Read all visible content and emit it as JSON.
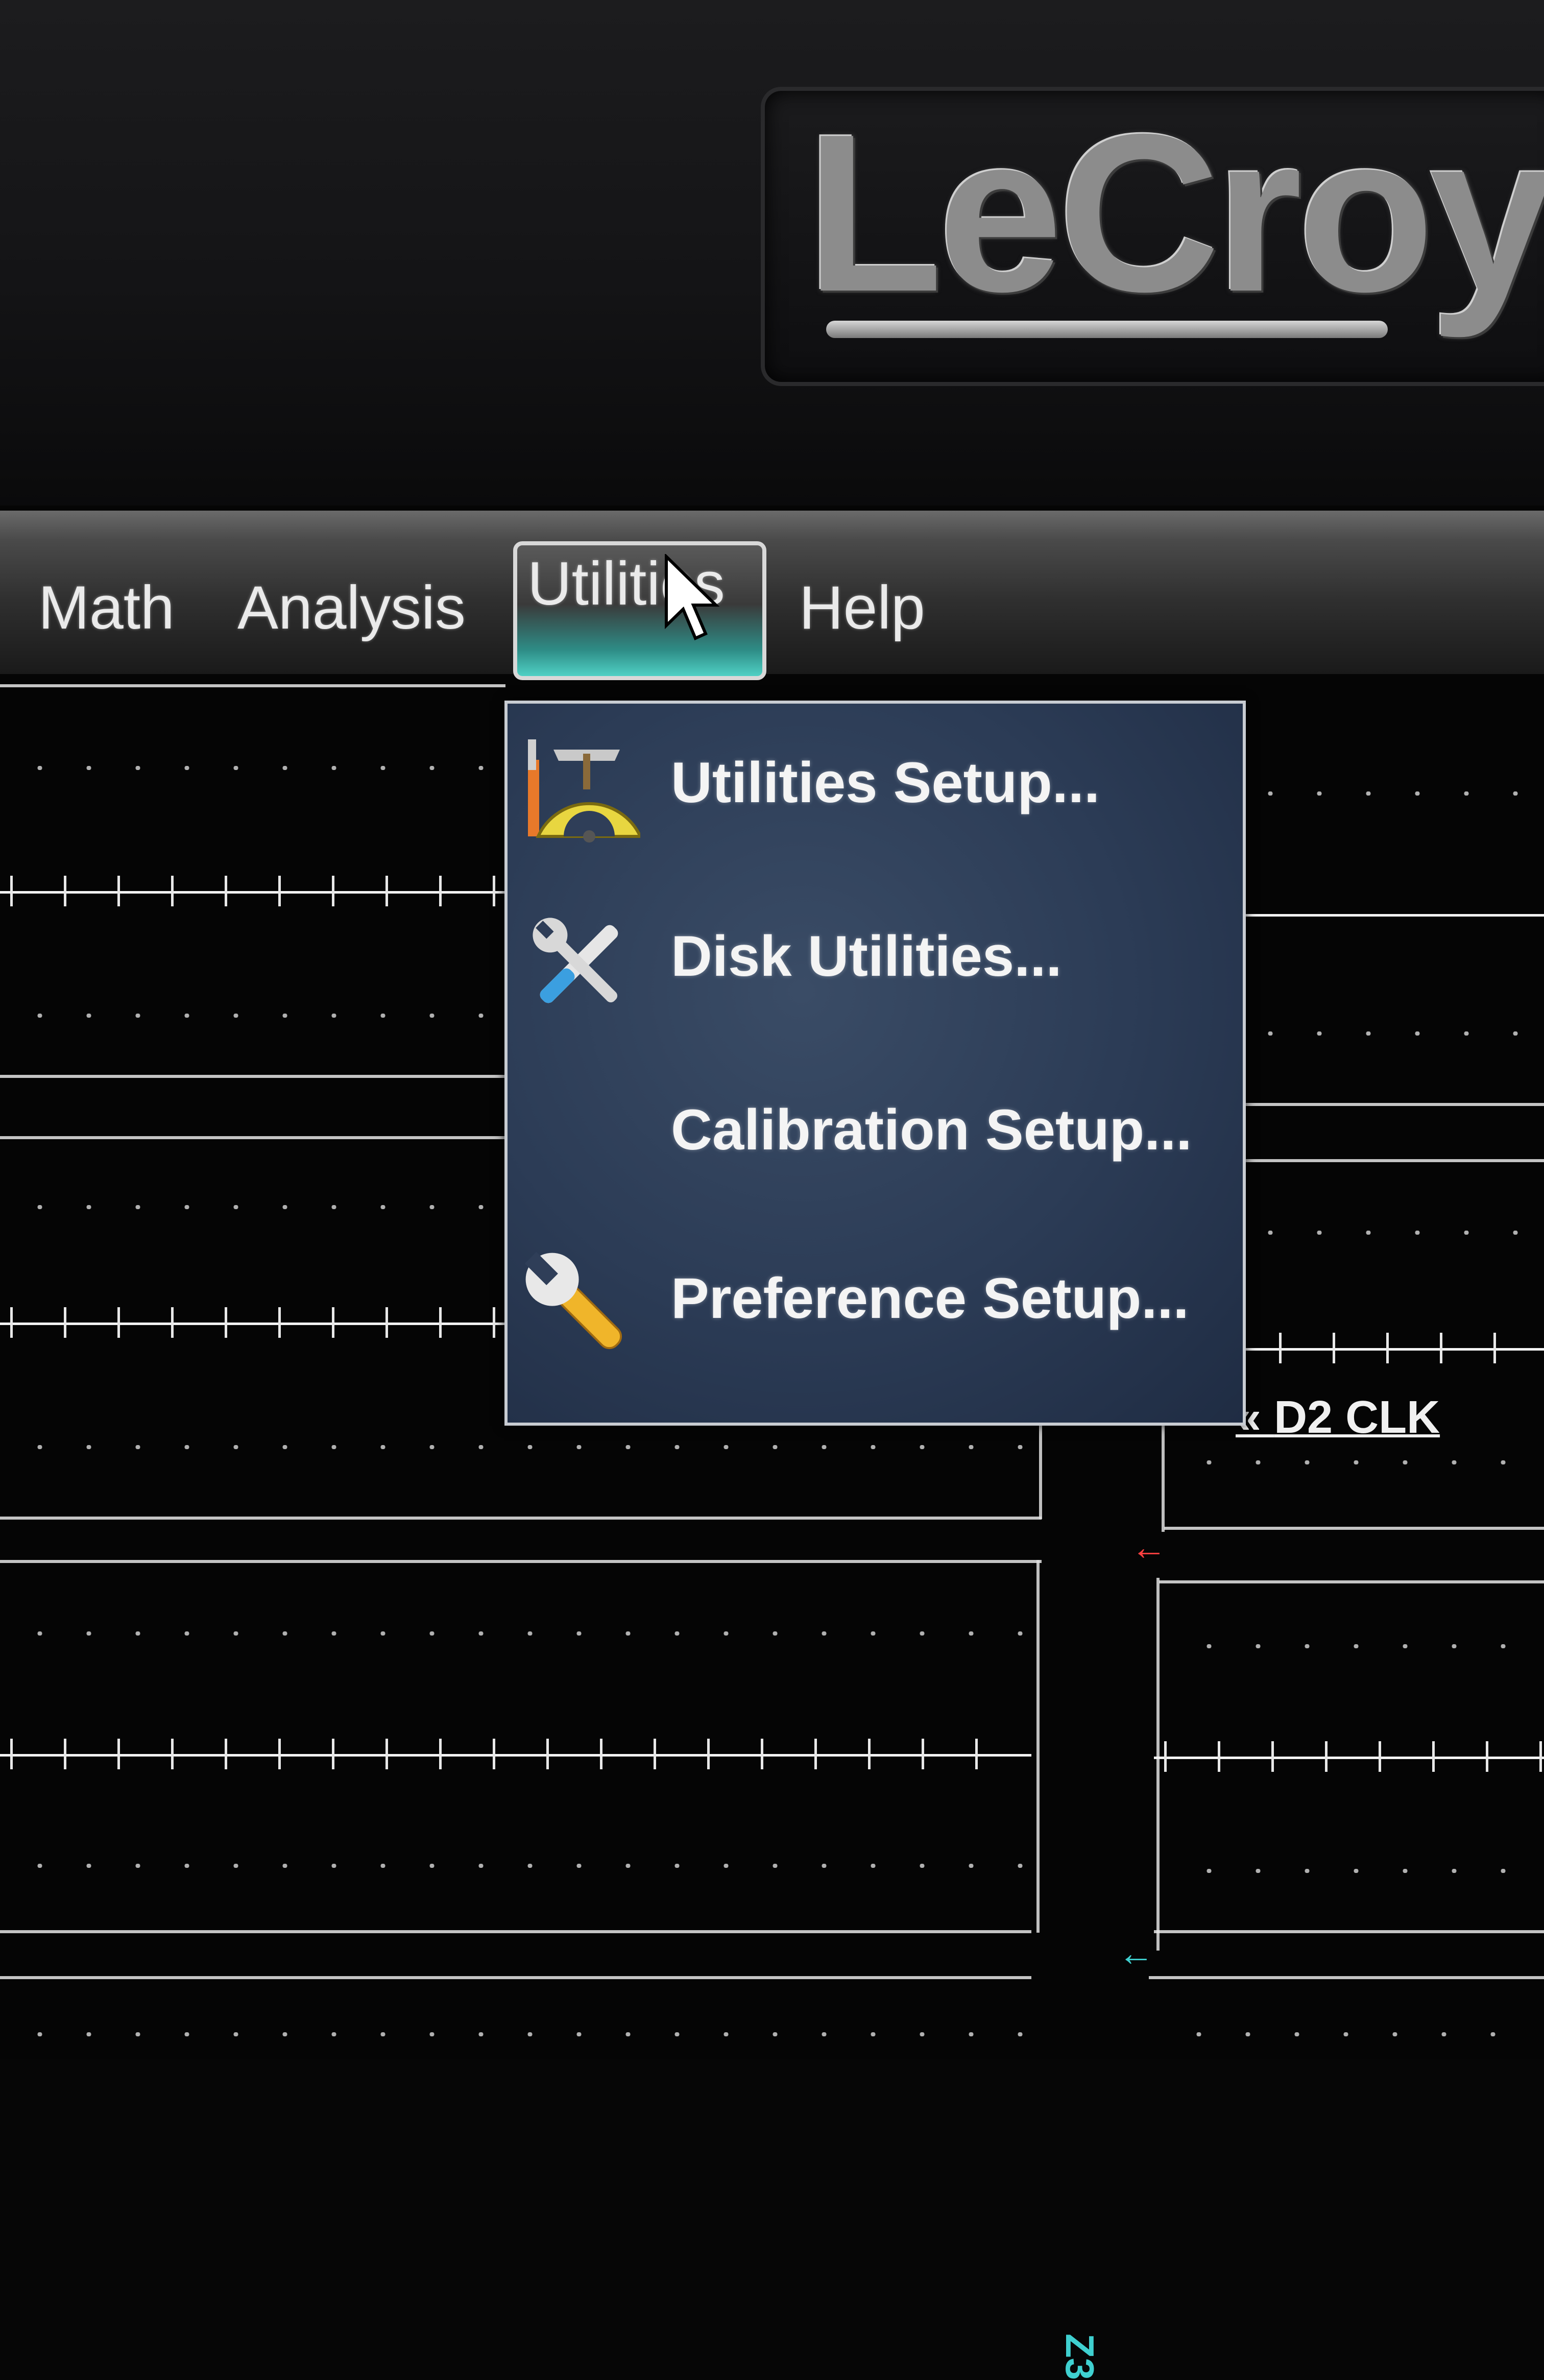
{
  "brand": {
    "logo_text": "LeCroy"
  },
  "menubar": {
    "items": [
      {
        "label": "Math"
      },
      {
        "label": "Analysis"
      },
      {
        "label": "Utilities"
      },
      {
        "label": "Help"
      }
    ],
    "active": "Utilities"
  },
  "utilities_menu": {
    "items": [
      {
        "label": "Utilities Setup...",
        "icon": "toolbox-protractor-icon"
      },
      {
        "label": "Disk Utilities...",
        "icon": "disk-tools-icon"
      },
      {
        "label": "Calibration Setup...",
        "icon": ""
      },
      {
        "label": "Preference Setup...",
        "icon": "wrench-icon"
      }
    ]
  },
  "traces": {
    "channel_label": "D2 CLK",
    "zoom_label": "Z3",
    "marker_color_red": "#ff4040",
    "marker_color_cyan": "#3fd0d0"
  }
}
